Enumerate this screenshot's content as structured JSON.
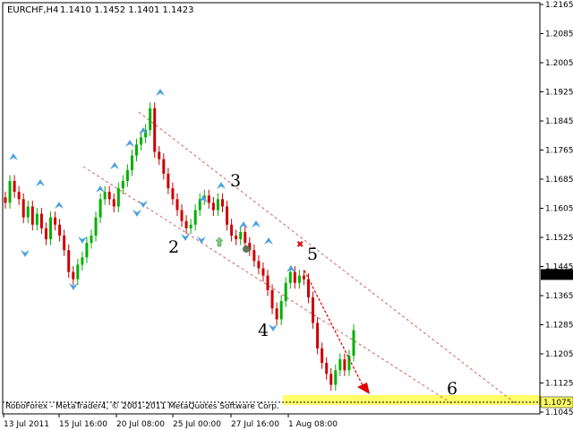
{
  "header": {
    "symbol": "EURCHF,H4",
    "ohlc": "1.1410 1.1452 1.1401 1.1423"
  },
  "footer": {
    "copyright": "RoboForex - MetaTrader4, © 2001-2011 MetaQuotes Software Corp."
  },
  "colors": {
    "bull": "#00b000",
    "bear": "#cc0000",
    "fractal": "#4aa0e0",
    "channel": "#d06060",
    "arrow": "#e00000",
    "zone": "#ffff66",
    "grid_axis": "#000000"
  },
  "chart_data": {
    "type": "candlestick",
    "ylim": [
      1.1045,
      1.2165
    ],
    "y_ticks": [
      "1.2165",
      "1.2085",
      "1.2005",
      "1.1925",
      "1.1845",
      "1.1765",
      "1.1685",
      "1.1605",
      "1.1525",
      "1.1445",
      "1.1365",
      "1.1285",
      "1.1205",
      "1.1125",
      "1.1045"
    ],
    "x_ticks": [
      "13 Jul 2011",
      "15 Jul 16:00",
      "20 Jul 08:00",
      "25 Jul 00:00",
      "27 Jul 16:00",
      "1 Aug 08:00"
    ],
    "current_price_label": "1.1423",
    "target_price_label": "1.1075",
    "wave_labels": [
      "2",
      "3",
      "4",
      "5",
      "6"
    ],
    "close_prices": [
      1.162,
      1.168,
      1.165,
      1.163,
      1.158,
      1.161,
      1.156,
      1.159,
      1.155,
      1.152,
      1.158,
      1.156,
      1.153,
      1.149,
      1.143,
      1.141,
      1.145,
      1.147,
      1.151,
      1.153,
      1.158,
      1.163,
      1.165,
      1.163,
      1.161,
      1.166,
      1.168,
      1.171,
      1.175,
      1.178,
      1.18,
      1.182,
      1.188,
      1.176,
      1.174,
      1.17,
      1.166,
      1.163,
      1.16,
      1.157,
      1.155,
      1.156,
      1.16,
      1.163,
      1.164,
      1.162,
      1.16,
      1.163,
      1.161,
      1.156,
      1.153,
      1.152,
      1.154,
      1.151,
      1.149,
      1.146,
      1.144,
      1.142,
      1.138,
      1.133,
      1.13,
      1.135,
      1.14,
      1.143,
      1.14,
      1.142,
      1.141,
      1.136,
      1.129,
      1.122,
      1.118,
      1.115,
      1.112,
      1.116,
      1.119,
      1.116,
      1.12,
      1.127
    ]
  }
}
